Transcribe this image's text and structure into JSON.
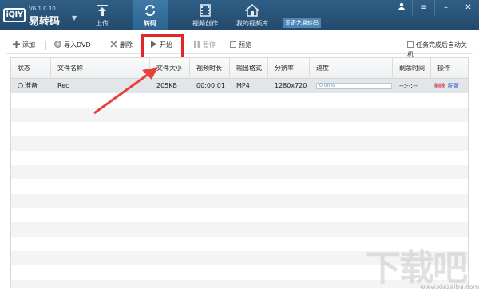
{
  "app": {
    "version": "V6.1.0.10",
    "name": "易转码",
    "logo_mark": "iQIY"
  },
  "nav": {
    "tabs": [
      {
        "label": "上传",
        "icon": "upload-icon"
      },
      {
        "label": "转码",
        "icon": "convert-icon",
        "active": true
      },
      {
        "label": "视频创作",
        "icon": "film-icon"
      },
      {
        "label": "我的视频库",
        "icon": "home-icon"
      }
    ],
    "promo": "爱奇艺易转码"
  },
  "window": {
    "buttons": [
      "user-icon",
      "menu-icon",
      "minimize-icon",
      "close-icon"
    ]
  },
  "toolbar": {
    "add": "添加",
    "import_dvd": "导入DVD",
    "delete": "删除",
    "start": "开始",
    "pause": "暂停",
    "preview": "预览",
    "auto_shutdown": "任务完成后自动关机"
  },
  "table": {
    "headers": [
      "状态",
      "文件名称",
      "文件大小",
      "视频时长",
      "输出格式",
      "分辨率",
      "进度",
      "剩余时间",
      "操作"
    ],
    "rows": [
      {
        "status": "准备",
        "name": "Rec",
        "size": "205KB",
        "duration": "00:00:01",
        "format": "MP4",
        "resolution": "1280x720",
        "progress_text": "0.00%",
        "progress": 0.0,
        "remaining": "--:--:--",
        "op_delete": "删除",
        "op_config": "配置"
      }
    ]
  },
  "watermark": {
    "text": "下载吧",
    "sub": "www.xiazaiba.com"
  },
  "colors": {
    "titlebar": "#2a5579",
    "highlight": "#e2262a",
    "arrow": "#e8403a",
    "link_red": "#d40f1e",
    "link_blue": "#1f5fc4"
  }
}
